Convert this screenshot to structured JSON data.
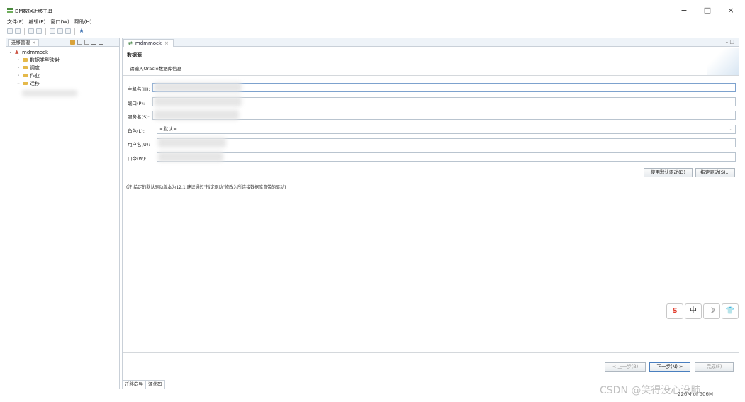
{
  "window": {
    "title": "DM数据迁移工具",
    "minimize": "−",
    "maximize": "□",
    "close": "×"
  },
  "menu": [
    "文件(F)",
    "编辑(E)",
    "窗口(W)",
    "帮助(H)"
  ],
  "left_panel": {
    "tab_label": "迁移管理",
    "tree": {
      "root": "mdmmock",
      "children": [
        "数据类型映射",
        "调度",
        "作业",
        "迁移"
      ]
    }
  },
  "editor": {
    "tab_label": "mdmmock",
    "header": {
      "title": "数据源",
      "description": "请输入Oracle数据库信息"
    },
    "form": {
      "host_label": "主机名(H):",
      "port_label": "端口(P):",
      "service_label": "服务名(S):",
      "role_label": "角色(L):",
      "role_value": "<默认>",
      "user_label": "用户名(U):",
      "password_label": "口令(W):"
    },
    "buttons": {
      "use_default_driver": "使用默认驱动(D)",
      "specify_driver": "指定驱动(S)..."
    },
    "note": "(注:给定的默认驱动版本为12.1,建议通过\"指定驱动\"修改为所连接数据库自带的驱动)",
    "nav": {
      "prev": "< 上一步(B)",
      "next": "下一步(N) >",
      "finish": "完成(F)"
    },
    "bottom_tabs": [
      "迁移向导",
      "源代码"
    ]
  },
  "ime_toolbar": [
    "S",
    "中",
    "☽",
    "👕"
  ],
  "watermark": "CSDN @笑得没心没肺",
  "status_text": "226M of 506M"
}
